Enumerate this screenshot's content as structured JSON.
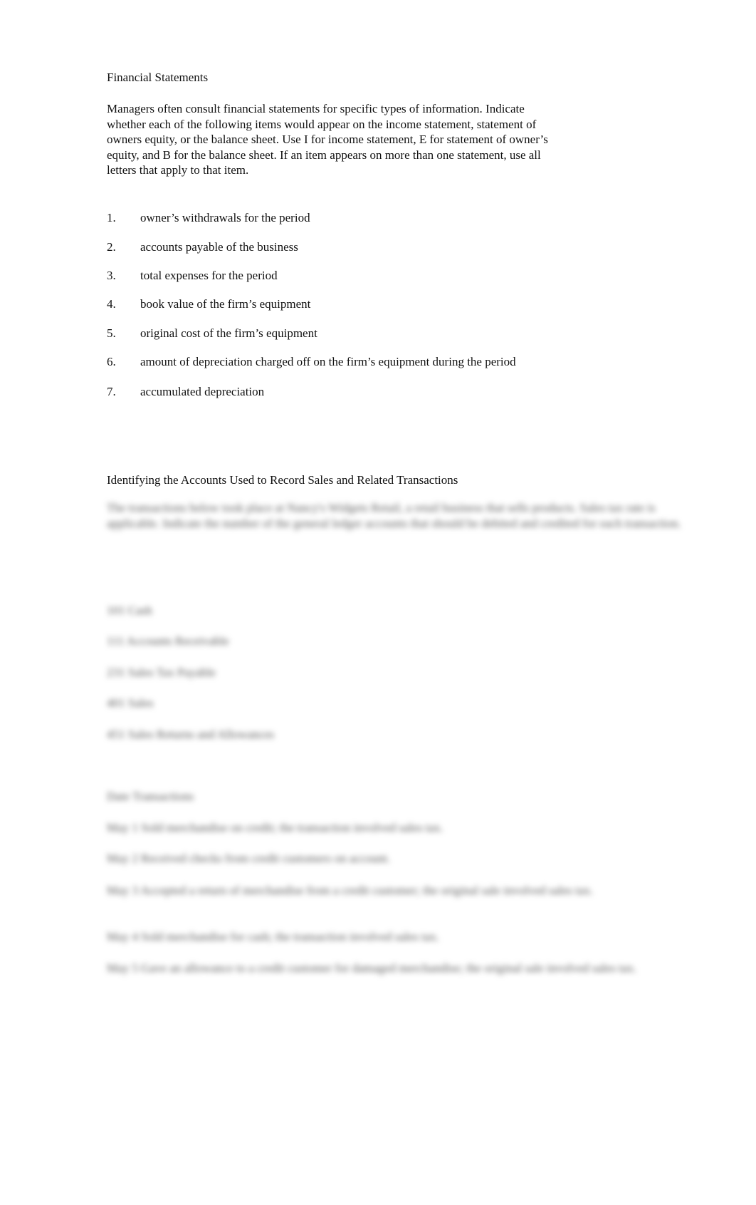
{
  "section1": {
    "title": "Financial Statements",
    "intro": "Managers often consult financial statements for specific types of information. Indicate whether each of the following items would appear on the income statement, statement of owners equity, or the balance sheet. Use I for income statement, E for statement of owner’s equity, and B for the balance sheet. If an item appears on more than one statement, use all letters that apply to that item.",
    "items": [
      {
        "num": "1.",
        "text": "owner’s withdrawals for the period"
      },
      {
        "num": "2.",
        "text": "accounts payable of the business"
      },
      {
        "num": "3.",
        "text": "total expenses for the period"
      },
      {
        "num": "4.",
        "text": "book value of the firm’s equipment"
      },
      {
        "num": "5.",
        "text": "original cost of the firm’s equipment"
      },
      {
        "num": "6.",
        "text": "amount of depreciation charged off on the firm’s equipment during the period"
      },
      {
        "num": "7.",
        "text": "accumulated depreciation"
      }
    ]
  },
  "section2": {
    "title": "Identifying the Accounts Used to Record Sales and Related Transactions",
    "blurred_intro": "The transactions below took place at Nancy's Widgets Retail, a retail business that sells products. Sales tax rate is applicable. Indicate the number of the general ledger accounts that should be debited and credited for each transaction.",
    "blurred_accounts": [
      "101 Cash",
      "111 Accounts Receivable",
      "231 Sales Tax Payable",
      "401 Sales",
      "451 Sales Returns and Allowances"
    ],
    "blurred_header": "Date    Transactions",
    "blurred_transactions": [
      "May 1    Sold merchandise on credit; the transaction involved sales tax.",
      "May 2    Received checks from credit customers on account.",
      "May 3    Accepted a return of merchandise from a credit customer; the original sale involved sales tax.",
      "May 4    Sold merchandise for cash; the transaction involved sales tax.",
      "May 5    Gave an allowance to a credit customer for damaged merchandise; the original sale involved sales tax."
    ]
  }
}
